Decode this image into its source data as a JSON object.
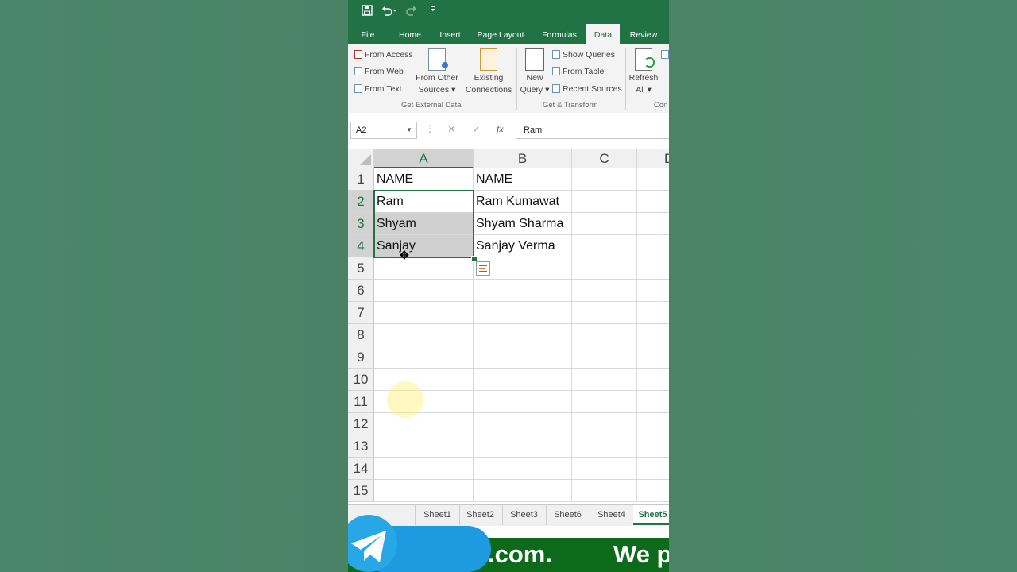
{
  "qat": {
    "save_icon": "save-icon",
    "undo_icon": "undo-icon",
    "redo_icon": "redo-icon",
    "customize_icon": "customize-qat-icon"
  },
  "tabs": [
    {
      "label": "File"
    },
    {
      "label": "Home"
    },
    {
      "label": "Insert"
    },
    {
      "label": "Page Layout"
    },
    {
      "label": "Formulas"
    },
    {
      "label": "Data"
    },
    {
      "label": "Review"
    }
  ],
  "active_tab": "Data",
  "ribbon": {
    "from_access": "From Access",
    "from_web": "From Web",
    "from_text": "From Text",
    "from_other_1": "From Other",
    "from_other_2": "Sources",
    "existing_1": "Existing",
    "existing_2": "Connections",
    "group_external": "Get External Data",
    "new_query_1": "New",
    "new_query_2": "Query",
    "show_queries": "Show Queries",
    "from_table": "From Table",
    "recent_sources": "Recent Sources",
    "group_transform": "Get & Transform",
    "refresh_1": "Refresh",
    "refresh_2": "All",
    "group_connections": "Con"
  },
  "formula_bar": {
    "name_box": "A2",
    "cancel": "✕",
    "enter": "✓",
    "fx": "fx",
    "value": "Ram"
  },
  "columns": [
    "A",
    "B",
    "C",
    "D"
  ],
  "rows": [
    "1",
    "2",
    "3",
    "4",
    "5",
    "6",
    "7",
    "8",
    "9",
    "10",
    "11",
    "12",
    "13",
    "14",
    "15"
  ],
  "cells": {
    "A1": "NAME",
    "B1": "NAME",
    "A2": "Ram",
    "B2": "Ram Kumawat",
    "A3": "Shyam",
    "B3": "Shyam Sharma",
    "A4": "Sanjay",
    "B4": "Sanjay Verma"
  },
  "sheet_tabs": [
    "Sheet1",
    "Sheet2",
    "Sheet3",
    "Sheet6",
    "Sheet4",
    "Sheet5"
  ],
  "active_sheet": "Sheet5",
  "banner": {
    "left_text": ".com.",
    "right_text": "We pro"
  },
  "colors": {
    "excel_green": "#217346",
    "banner_green": "#0d6a1a",
    "telegram_blue": "#1e9be0"
  }
}
